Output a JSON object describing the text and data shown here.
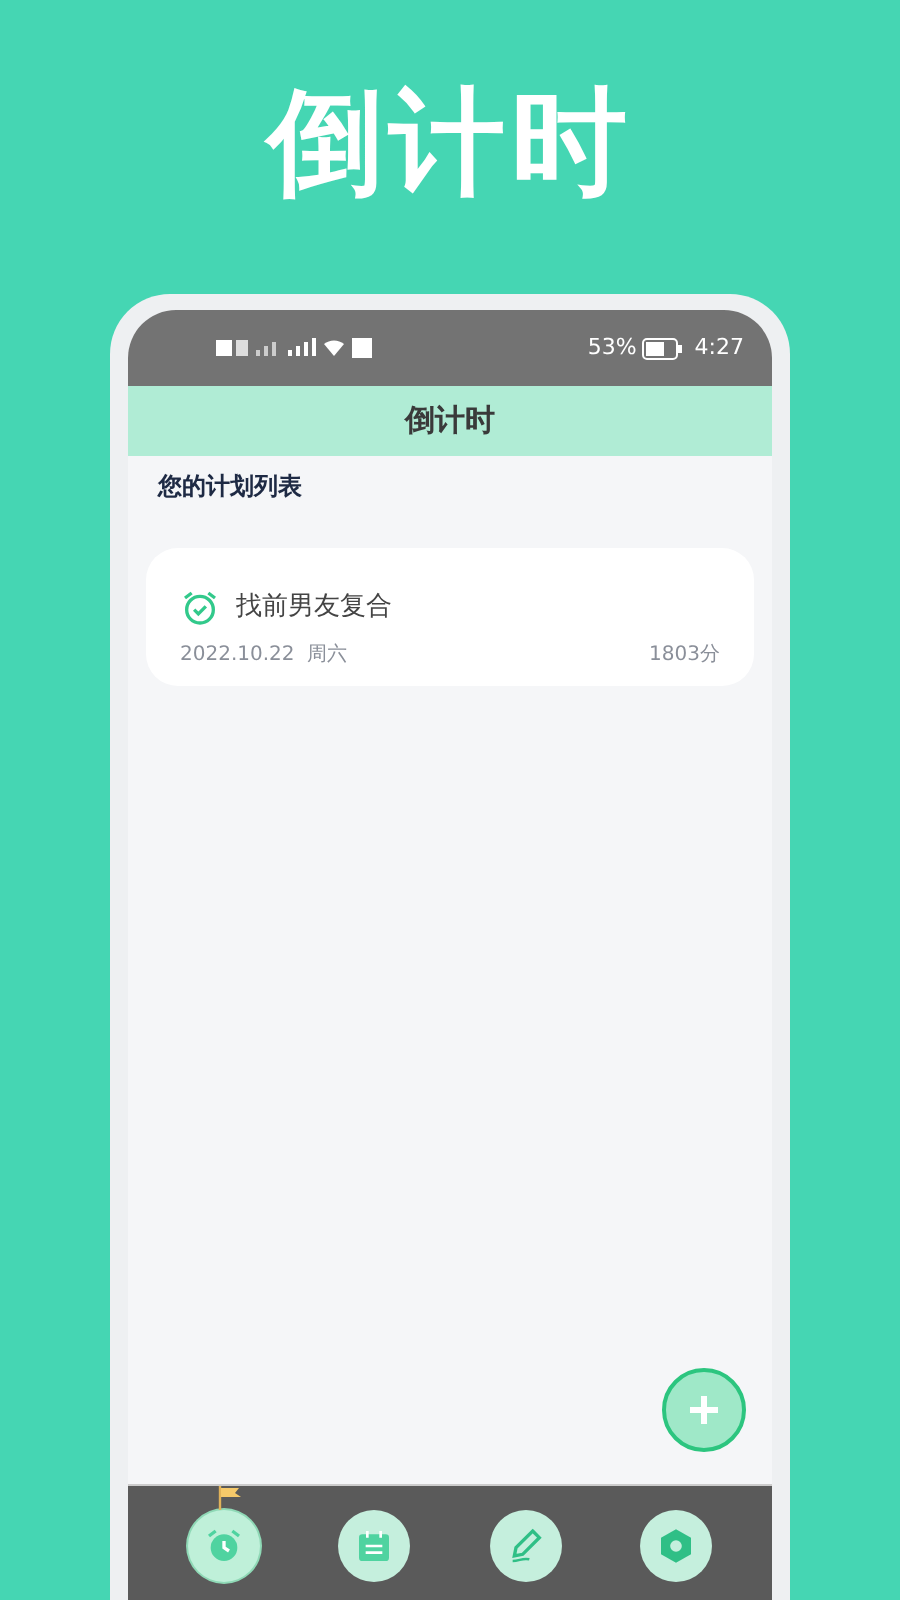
{
  "promo_title": "倒计时",
  "status_bar": {
    "battery": "53%",
    "time": "4:27"
  },
  "header": {
    "title": "倒计时"
  },
  "section_title": "您的计划列表",
  "plans": [
    {
      "title": "找前男友复合",
      "date": "2022.10.22",
      "weekday": "周六",
      "minutes": "1803分"
    }
  ],
  "tabs": [
    {
      "kind": "alarm",
      "selected": true
    },
    {
      "kind": "calendar",
      "selected": false
    },
    {
      "kind": "pen",
      "selected": false
    },
    {
      "kind": "settings",
      "selected": false
    }
  ]
}
